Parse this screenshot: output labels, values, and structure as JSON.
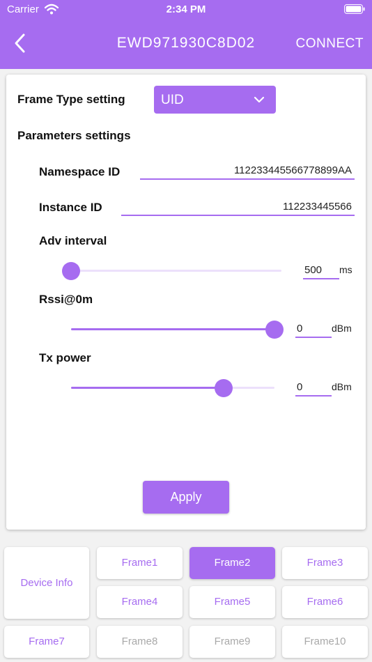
{
  "status_bar": {
    "carrier": "Carrier",
    "time": "2:34 PM"
  },
  "header": {
    "title": "EWD971930C8D02",
    "connect_label": "CONNECT"
  },
  "frame_type": {
    "label": "Frame Type setting",
    "value": "UID"
  },
  "parameters": {
    "label": "Parameters settings",
    "namespace": {
      "label": "Namespace ID",
      "value": "112233445566778899AA"
    },
    "instance": {
      "label": "Instance ID",
      "value": "112233445566"
    },
    "adv_interval": {
      "label": "Adv interval",
      "value": "500",
      "unit": "ms",
      "slider_fraction": 0.0
    },
    "rssi": {
      "label": "Rssi@0m",
      "value": "0",
      "unit": "dBm",
      "slider_fraction": 1.0
    },
    "tx_power": {
      "label": "Tx power",
      "value": "0",
      "unit": "dBm",
      "slider_fraction": 0.75
    }
  },
  "apply_label": "Apply",
  "tabs": {
    "device_info": "Device Info",
    "frames": [
      "Frame1",
      "Frame2",
      "Frame3",
      "Frame4",
      "Frame5",
      "Frame6",
      "Frame7",
      "Frame8",
      "Frame9",
      "Frame10"
    ],
    "active": "Frame2",
    "disabled": [
      "Frame8",
      "Frame9",
      "Frame10"
    ]
  },
  "colors": {
    "accent": "#a66cf0",
    "track": "#ece0fb",
    "disabled_text": "#a9a9a9"
  }
}
